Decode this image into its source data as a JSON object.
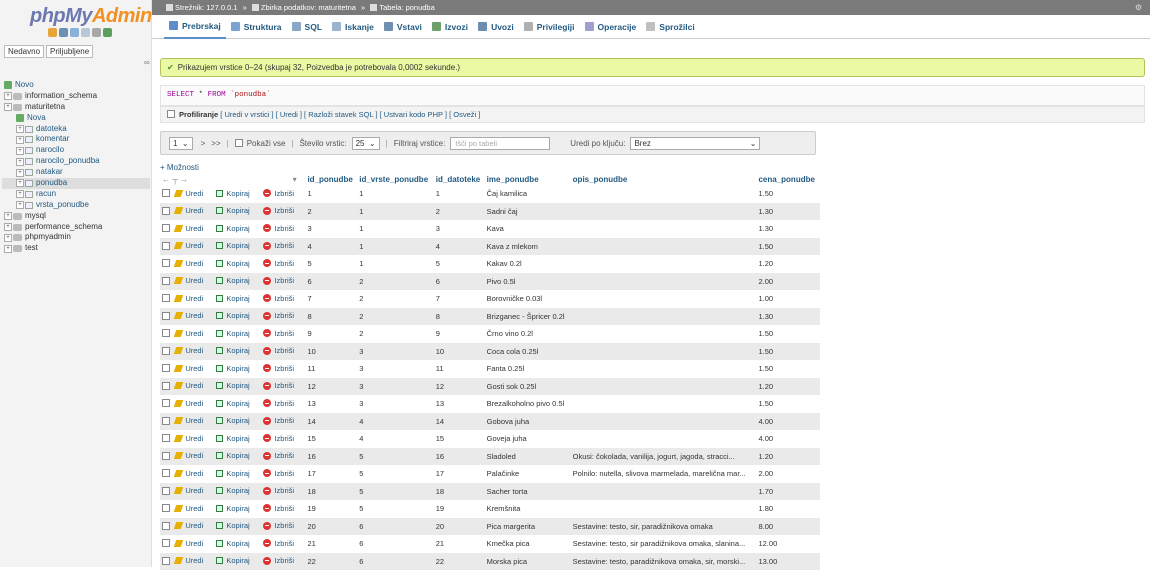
{
  "logo": {
    "php": "php",
    "my": "My",
    "admin": "Admin"
  },
  "nav": {
    "tab_recent": "Nedavno",
    "tab_favorites": "Priljubljene",
    "link_icon": "link-icon",
    "tree": [
      {
        "label": "Novo",
        "kind": "new",
        "level": 0
      },
      {
        "label": "information_schema",
        "kind": "db",
        "level": 0
      },
      {
        "label": "maturitetna",
        "kind": "db",
        "level": 0
      },
      {
        "label": "Nova",
        "kind": "new",
        "level": 1
      },
      {
        "label": "datoteka",
        "kind": "table",
        "level": 1
      },
      {
        "label": "komentar",
        "kind": "table",
        "level": 1
      },
      {
        "label": "narocilo",
        "kind": "table",
        "level": 1
      },
      {
        "label": "narocilo_ponudba",
        "kind": "table",
        "level": 1
      },
      {
        "label": "natakar",
        "kind": "table",
        "level": 1
      },
      {
        "label": "ponudba",
        "kind": "table",
        "level": 1,
        "selected": true
      },
      {
        "label": "racun",
        "kind": "table",
        "level": 1
      },
      {
        "label": "vrsta_ponudbe",
        "kind": "table",
        "level": 1
      },
      {
        "label": "mysql",
        "kind": "db",
        "level": 0
      },
      {
        "label": "performance_schema",
        "kind": "db",
        "level": 0
      },
      {
        "label": "phpmyadmin",
        "kind": "db",
        "level": 0
      },
      {
        "label": "test",
        "kind": "db",
        "level": 0
      }
    ]
  },
  "breadcrumb": {
    "server": "Strežnik: 127.0.0.1",
    "database": "Zbirka podatkov: maturitetna",
    "table": "Tabela: ponudba"
  },
  "tabs": [
    {
      "label": "Prebrskaj",
      "icon": "browse-icon",
      "color": "#5c8fc7",
      "active": true
    },
    {
      "label": "Struktura",
      "icon": "structure-icon",
      "color": "#7aa3d1"
    },
    {
      "label": "SQL",
      "icon": "sql-icon",
      "color": "#8aa7c8"
    },
    {
      "label": "Iskanje",
      "icon": "search-icon",
      "color": "#9bb3cc"
    },
    {
      "label": "Vstavi",
      "icon": "insert-icon",
      "color": "#6f8fb0"
    },
    {
      "label": "Izvozi",
      "icon": "export-icon",
      "color": "#6ca16c"
    },
    {
      "label": "Uvozi",
      "icon": "import-icon",
      "color": "#6c8fb0"
    },
    {
      "label": "Privilegiji",
      "icon": "privileges-icon",
      "color": "#b0b0b0"
    },
    {
      "label": "Operacije",
      "icon": "operations-icon",
      "color": "#a0a0d0"
    },
    {
      "label": "Sprožilci",
      "icon": "triggers-icon",
      "color": "#c0c0c0"
    }
  ],
  "message": "Prikazujem vrstice 0–24 (skupaj 32, Poizvedba je potrebovala 0,0002 sekunde.)",
  "sql": {
    "select": "SELECT",
    "star": "*",
    "from": "FROM",
    "table": "`ponudba`"
  },
  "profiling": {
    "label": "Profiliranje",
    "links": "[ Uredi v vrstici ] [ Uredi ] [ Razloži stavek SQL ] [ Ustvari kodo PHP ] [ Osveži ]"
  },
  "navbar": {
    "page": "1",
    "next": ">",
    "last": ">>",
    "show_all": "Pokaži vse",
    "rows_label": "Število vrstic:",
    "rows_value": "25",
    "filter_label": "Filtriraj vrstice:",
    "filter_placeholder": "Išči po tabeli",
    "sort_label": "Uredi po ključu:",
    "sort_value": "Brez"
  },
  "options_label": "+ Možnosti",
  "columns": [
    "id_ponudbe",
    "id_vrste_ponudbe",
    "id_datoteke",
    "ime_ponudbe",
    "opis_ponudbe",
    "cena_ponudbe"
  ],
  "actions": {
    "edit": "Uredi",
    "copy": "Kopiraj",
    "delete": "Izbriši"
  },
  "rows": [
    [
      "1",
      "1",
      "1",
      "Čaj kamilica",
      "",
      "1.50"
    ],
    [
      "2",
      "1",
      "2",
      "Sadni čaj",
      "",
      "1.30"
    ],
    [
      "3",
      "1",
      "3",
      "Kava",
      "",
      "1.30"
    ],
    [
      "4",
      "1",
      "4",
      "Kava z mlekom",
      "",
      "1.50"
    ],
    [
      "5",
      "1",
      "5",
      "Kakav 0.2l",
      "",
      "1.20"
    ],
    [
      "6",
      "2",
      "6",
      "Pivo 0.5l",
      "",
      "2.00"
    ],
    [
      "7",
      "2",
      "7",
      "Borovničke 0.03l",
      "",
      "1.00"
    ],
    [
      "8",
      "2",
      "8",
      "Brizganec - Špricer 0.2l",
      "",
      "1.30"
    ],
    [
      "9",
      "2",
      "9",
      "Črno vino 0.2l",
      "",
      "1.50"
    ],
    [
      "10",
      "3",
      "10",
      "Coca cola 0.25l",
      "",
      "1.50"
    ],
    [
      "11",
      "3",
      "11",
      "Fanta 0.25l",
      "",
      "1.50"
    ],
    [
      "12",
      "3",
      "12",
      "Gosti sok 0.25l",
      "",
      "1.20"
    ],
    [
      "13",
      "3",
      "13",
      "Brezalkoholno pivo 0.5l",
      "",
      "1.50"
    ],
    [
      "14",
      "4",
      "14",
      "Gobova juha",
      "",
      "4.00"
    ],
    [
      "15",
      "4",
      "15",
      "Goveja juha",
      "",
      "4.00"
    ],
    [
      "16",
      "5",
      "16",
      "Sladoled",
      "Okusi: čokolada, vanilija, jogurt, jagoda, stracci...",
      "1.20"
    ],
    [
      "17",
      "5",
      "17",
      "Palačinke",
      "Polnilo: nutella, slivova marmelada, marelična mar...",
      "2.00"
    ],
    [
      "18",
      "5",
      "18",
      "Sacher torta",
      "",
      "1.70"
    ],
    [
      "19",
      "5",
      "19",
      "Kremšnita",
      "",
      "1.80"
    ],
    [
      "20",
      "6",
      "20",
      "Pica margerita",
      "Sestavine: testo, sir, paradižnikova omaka",
      "8.00"
    ],
    [
      "21",
      "6",
      "21",
      "Kmečka pica",
      "Sestavine: testo, sir paradižnikova omaka, slanina...",
      "12.00"
    ],
    [
      "22",
      "6",
      "22",
      "Morska pica",
      "Sestavine: testo, paradižnikova omaka, sir, morski...",
      "13.00"
    ]
  ]
}
